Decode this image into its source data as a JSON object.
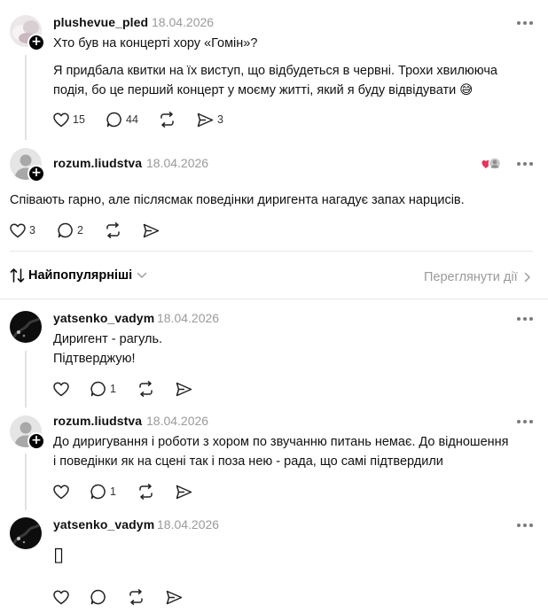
{
  "thread_post": {
    "username": "plushevue_pled",
    "date": "18.04.2026",
    "title": "Хто був на концерті хору «Гомін»?",
    "body_line1": "Я придбала квитки на їх виступ, що відбудеться в червні. Трохи хвилююча",
    "body_line2": "подія, бо це перший концерт у моєму житті, який я буду відвідувати",
    "emoji": "😅",
    "likes": "15",
    "comments": "44",
    "shares": "3"
  },
  "reply_main": {
    "username": "rozum.liudstva",
    "date": "18.04.2026",
    "text": "Співають гарно, але післясмак поведінки диригента нагадує запах нарцисів.",
    "likes": "3",
    "comments": "2"
  },
  "sort_bar": {
    "label": "Найпопулярніші",
    "view_activity": "Переглянути дії"
  },
  "comments": [
    {
      "username": "yatsenko_vadym",
      "date": "18.04.2026",
      "line1": "Диригент - рагуль.",
      "line2": "Підтверджую!",
      "comments": "1"
    },
    {
      "username": "rozum.liudstva",
      "date": "18.04.2026",
      "line1": "До диригування і роботи з хором по звучанню питань немає. До відношення",
      "line2": "і поведінки як на сцені так і поза нею - рада, що самі підтвердили",
      "comments": "1"
    },
    {
      "username": "yatsenko_vadym",
      "date": "18.04.2026",
      "glyph": "▯"
    }
  ],
  "colors": {
    "text": "#111111",
    "muted": "#9a9a9a",
    "divider": "#e6e6e6",
    "heart_reaction": "#e8335a"
  },
  "icons": [
    "heart-icon",
    "comment-icon",
    "repost-icon",
    "share-icon",
    "more-icon",
    "sort-icon",
    "chevron-down-icon",
    "chevron-right-icon"
  ]
}
